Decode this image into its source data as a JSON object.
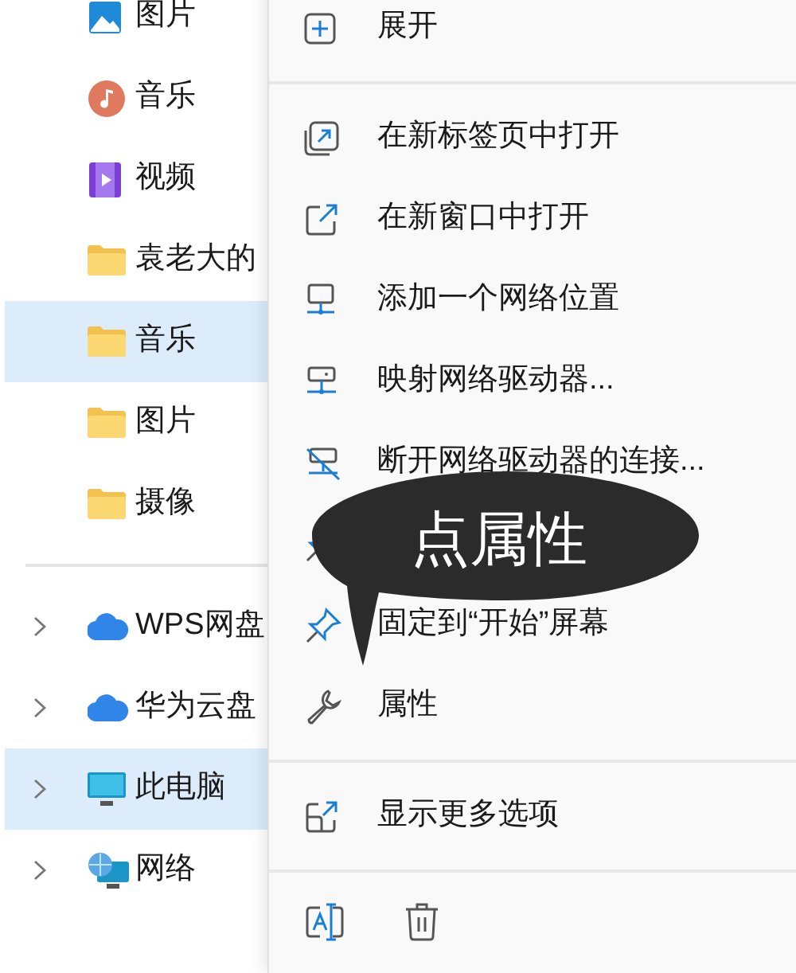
{
  "sidebar": {
    "items": [
      {
        "kind": "images",
        "label": "图片",
        "selected": false,
        "expandable": false
      },
      {
        "kind": "music",
        "label": "音乐",
        "selected": false,
        "expandable": false
      },
      {
        "kind": "video",
        "label": "视频",
        "selected": false,
        "expandable": false
      },
      {
        "kind": "folder",
        "label": "袁老大的",
        "selected": false,
        "expandable": false
      },
      {
        "kind": "folder",
        "label": "音乐",
        "selected": true,
        "expandable": false
      },
      {
        "kind": "folder",
        "label": "图片",
        "selected": false,
        "expandable": false
      },
      {
        "kind": "folder",
        "label": "摄像",
        "selected": false,
        "expandable": false
      },
      {
        "kind": "separator"
      },
      {
        "kind": "cloud",
        "label": "WPS网盘",
        "selected": false,
        "expandable": true
      },
      {
        "kind": "cloud",
        "label": "华为云盘",
        "selected": false,
        "expandable": true
      },
      {
        "kind": "pc",
        "label": "此电脑",
        "selected": true,
        "expandable": true
      },
      {
        "kind": "network",
        "label": "网络",
        "selected": false,
        "expandable": true
      }
    ]
  },
  "context_menu": {
    "items": [
      {
        "kind": "expand",
        "label": "展开"
      },
      {
        "kind": "separator"
      },
      {
        "kind": "new-tab",
        "label": "在新标签页中打开"
      },
      {
        "kind": "new-window",
        "label": "在新窗口中打开"
      },
      {
        "kind": "add-location",
        "label": "添加一个网络位置"
      },
      {
        "kind": "map-drive",
        "label": "映射网络驱动器..."
      },
      {
        "kind": "disconnect",
        "label": "断开网络驱动器的连接..."
      },
      {
        "kind": "pin"
      },
      {
        "kind": "pin",
        "label": "固定到“开始”屏幕"
      },
      {
        "kind": "properties",
        "label": "属性"
      },
      {
        "kind": "separator"
      },
      {
        "kind": "more",
        "label": "显示更多选项"
      },
      {
        "kind": "separator"
      }
    ],
    "toolbar": [
      {
        "kind": "rename"
      },
      {
        "kind": "delete"
      }
    ]
  },
  "callout": {
    "text": "点属性"
  }
}
